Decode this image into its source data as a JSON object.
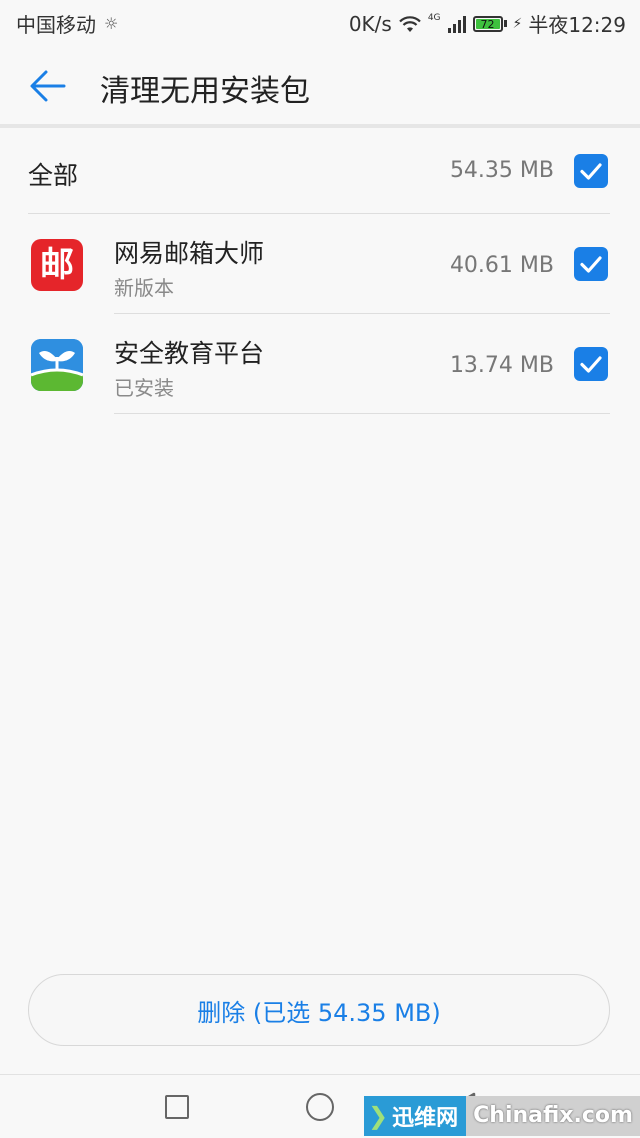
{
  "status_bar": {
    "carrier": "中国移动",
    "net_speed": "0K/s",
    "lte": "4G",
    "battery_level": "72",
    "time": "半夜12:29",
    "icons": [
      "sun-icon",
      "wifi-icon",
      "signal-icon",
      "battery-icon",
      "bolt-icon"
    ]
  },
  "app_bar": {
    "title": "清理无用安装包",
    "back_icon": "arrow-left-icon"
  },
  "list": {
    "all_row": {
      "label": "全部",
      "size": "54.35 MB",
      "checked": true
    },
    "apps": [
      {
        "name": "网易邮箱大师",
        "subtitle": "新版本",
        "size": "40.61 MB",
        "checked": true,
        "icon": "mail-app-icon",
        "icon_glyph": "邮"
      },
      {
        "name": "安全教育平台",
        "subtitle": "已安装",
        "size": "13.74 MB",
        "checked": true,
        "icon": "sprout-app-icon"
      }
    ]
  },
  "delete_button": {
    "label": "删除 (已选 54.35 MB)"
  },
  "watermark": {
    "left_text": "迅维网",
    "right_text": "Chinafix.com"
  },
  "colors": {
    "accent": "#1a7fe6",
    "background": "#f8f8f8",
    "mail_icon_red": "#e5252a",
    "sprout_icon_blue": "#2f8fe0",
    "sprout_icon_green": "#5cb832"
  }
}
